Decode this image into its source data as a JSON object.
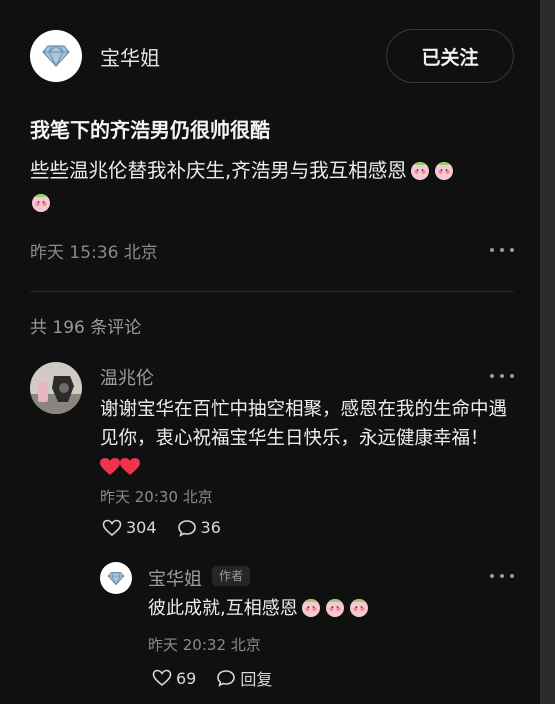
{
  "author": {
    "name": "宝华姐",
    "avatar_icon": "diamond-icon",
    "follow_label": "已关注"
  },
  "post": {
    "title": "我笔下的齐浩男仍很帅很酷",
    "body": "些些温兆伦替我补庆生,齐浩男与我互相感恩",
    "emoji_icon": "peach-face-emoji",
    "time": "昨天 15:36 北京"
  },
  "comments": {
    "count_label": "共 196 条评论",
    "items": [
      {
        "name": "温兆伦",
        "text": "谢谢宝华在百忙中抽空相聚，感恩在我的生命中遇见你，衷心祝福宝华生日快乐，永远健康幸福！",
        "heart_icon": "red-heart-emoji",
        "time": "昨天 20:30 北京",
        "likes": "304",
        "replies": "36"
      }
    ],
    "reply": {
      "name": "宝华姐",
      "badge": "作者",
      "text": "彼此成就,互相感恩",
      "time": "昨天 20:32 北京",
      "likes": "69",
      "reply_label": "回复"
    }
  },
  "colors": {
    "background": "#101010",
    "heart": "#f0344f",
    "muted": "#8a8a8a"
  }
}
